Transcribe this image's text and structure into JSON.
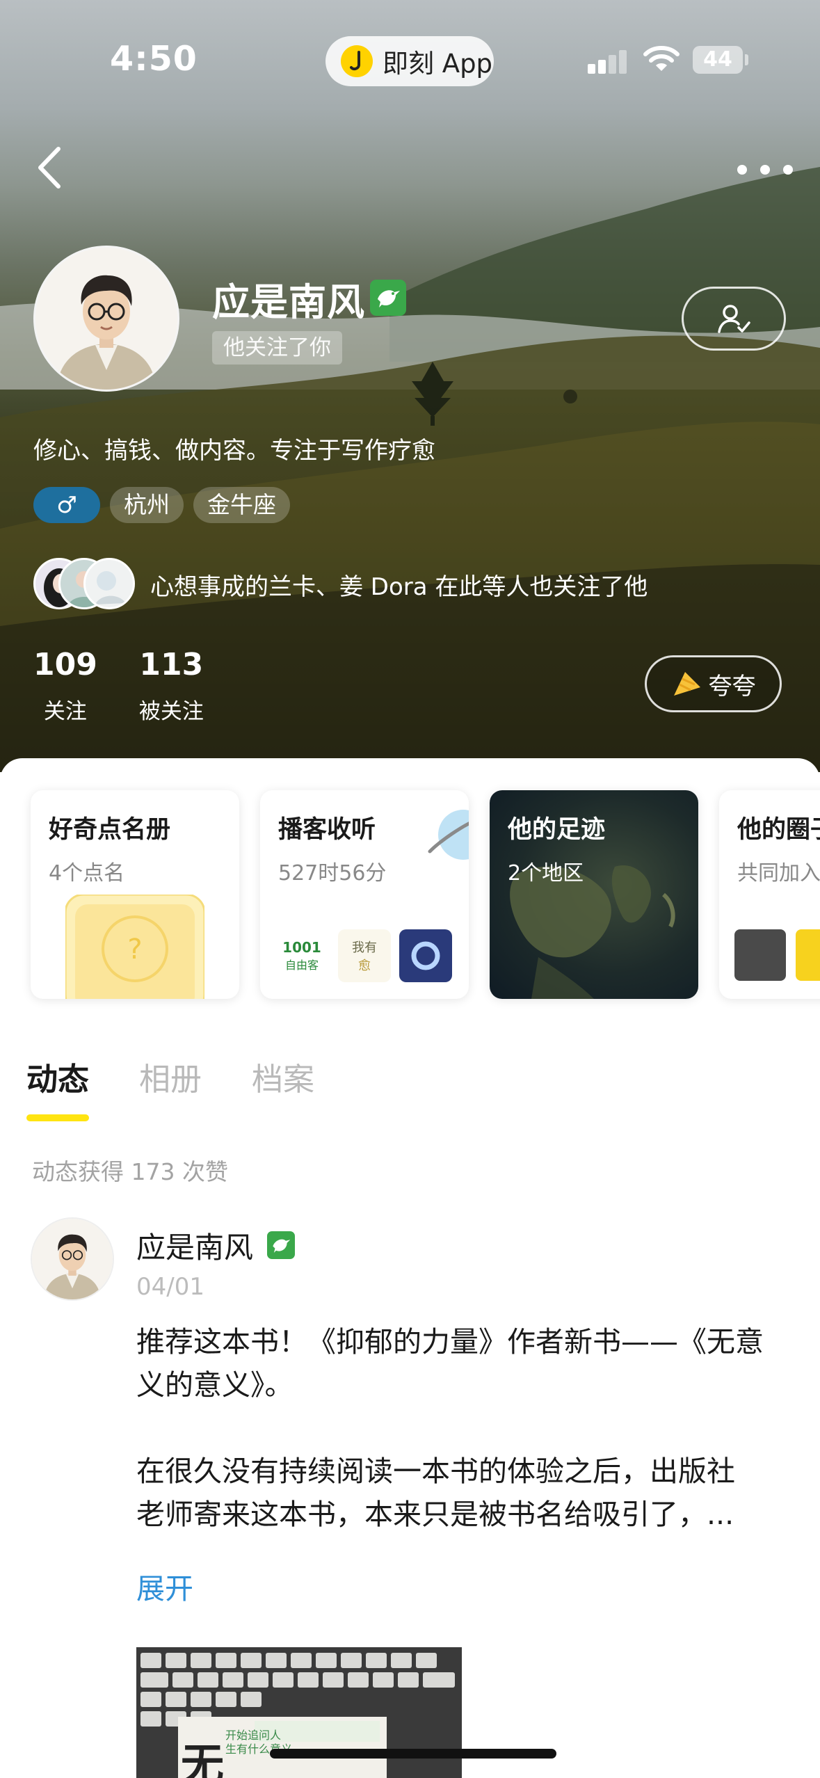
{
  "status_bar": {
    "time": "4:50",
    "app_name": "即刻 App",
    "battery": "44"
  },
  "profile": {
    "name": "应是南风",
    "follows_you": "他关注了你",
    "bio": "修心、搞钱、做内容。专注于写作疗愈",
    "gender_symbol": "♂",
    "tags": [
      "杭州",
      "金牛座"
    ],
    "mutual_followers_text": "心想事成的兰卡、姜 Dora 在此等人也关注了他",
    "stats": [
      {
        "value": "109",
        "label": "关注"
      },
      {
        "value": "113",
        "label": "被关注"
      }
    ],
    "praise_label": "夸夸"
  },
  "cards": [
    {
      "title": "好奇点名册",
      "subtitle": "4个点名"
    },
    {
      "title": "播客收听",
      "subtitle": "527时56分"
    },
    {
      "title": "他的足迹",
      "subtitle": "2个地区"
    },
    {
      "title": "他的圈子",
      "subtitle": "共同加入"
    }
  ],
  "podcast_logos": [
    "1001",
    "自由客",
    "我有",
    "愈"
  ],
  "tabs": [
    {
      "label": "动态",
      "active": true
    },
    {
      "label": "相册",
      "active": false
    },
    {
      "label": "档案",
      "active": false
    }
  ],
  "likes_summary": "动态获得 173 次赞",
  "post": {
    "author": "应是南风",
    "date": "04/01",
    "body_lines": [
      "推荐这本书！《抑郁的力量》作者新书——《无意",
      "义的意义》。",
      "",
      "在很久没有持续阅读一本书的体验之后，出版社",
      "老师寄来这本书，本来只是被书名给吸引了，..."
    ],
    "expand_label": "展开",
    "image_text": [
      "无",
      "开始追问人",
      "生有什么意义"
    ]
  },
  "colors": {
    "accent_yellow": "#ffe411",
    "link_blue": "#2f8fd8",
    "badge_green": "#3aa84a",
    "gender_blue": "#1e6f9e"
  }
}
